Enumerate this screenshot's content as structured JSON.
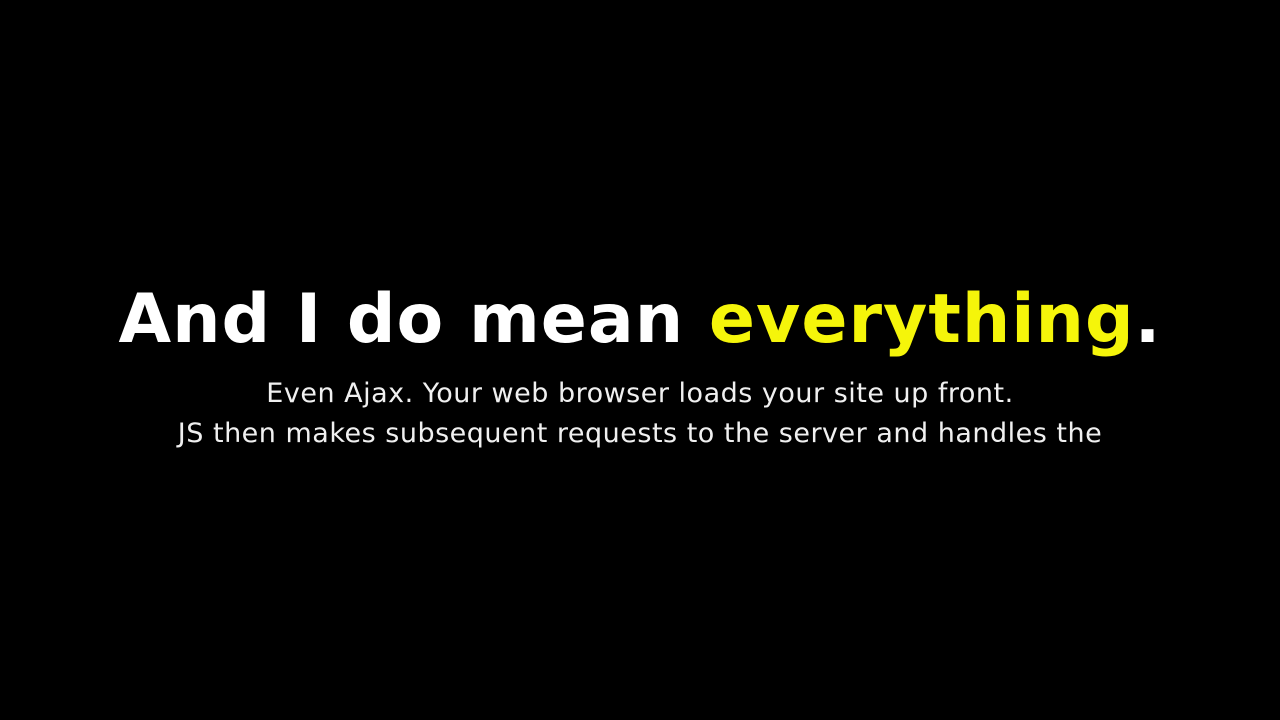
{
  "slide": {
    "headline": {
      "lead": "And I do mean ",
      "emphasis": "everything",
      "trail": "."
    },
    "body_lines": [
      "Even Ajax. Your web browser loads your site up front.",
      "JS then makes subsequent requests to the server and handles the"
    ]
  },
  "colors": {
    "background": "#000000",
    "text": "#ffffff",
    "accent": "#f5f50a"
  }
}
